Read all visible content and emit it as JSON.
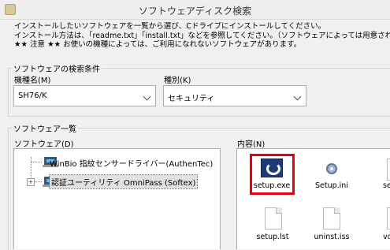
{
  "window": {
    "title": "ソフトウェアディスク検索"
  },
  "intro": {
    "line1": "インストールしたいソフトウェアを一覧から選び、Cドライブにインストールしてください。",
    "line2": "インストール方法は、「readme.txt」「install.txt」などを参照してください。（ソフトウェアによっては用意されていない場合も",
    "line3": "★★ 注意 ★★ お使いの機種によっては、ご利用になれないソフトウェアがあります。"
  },
  "search": {
    "group_label": "ソフトウェアの検索条件",
    "model_label": "機種名(M)",
    "model_value": "SH76/K",
    "category_label": "種別(K)",
    "category_value": "セキュリティ"
  },
  "list": {
    "group_label": "ソフトウェア一覧",
    "software_label": "ソフトウェア(D)",
    "contents_label": "内容(N)",
    "software": [
      {
        "label": "WinBio 指紋センサードライバー(AuthenTec)"
      },
      {
        "label": "認証ユーティリティ OmniPass (Softex)"
      }
    ],
    "files": [
      {
        "label": "setup.exe"
      },
      {
        "label": "Setup.ini"
      },
      {
        "label": "se"
      },
      {
        "label": "setup.lst"
      },
      {
        "label": "uninst.iss"
      },
      {
        "label": "vcred"
      }
    ]
  },
  "colors": {
    "highlight": "#e60012",
    "panel": "#f0f0f0"
  }
}
